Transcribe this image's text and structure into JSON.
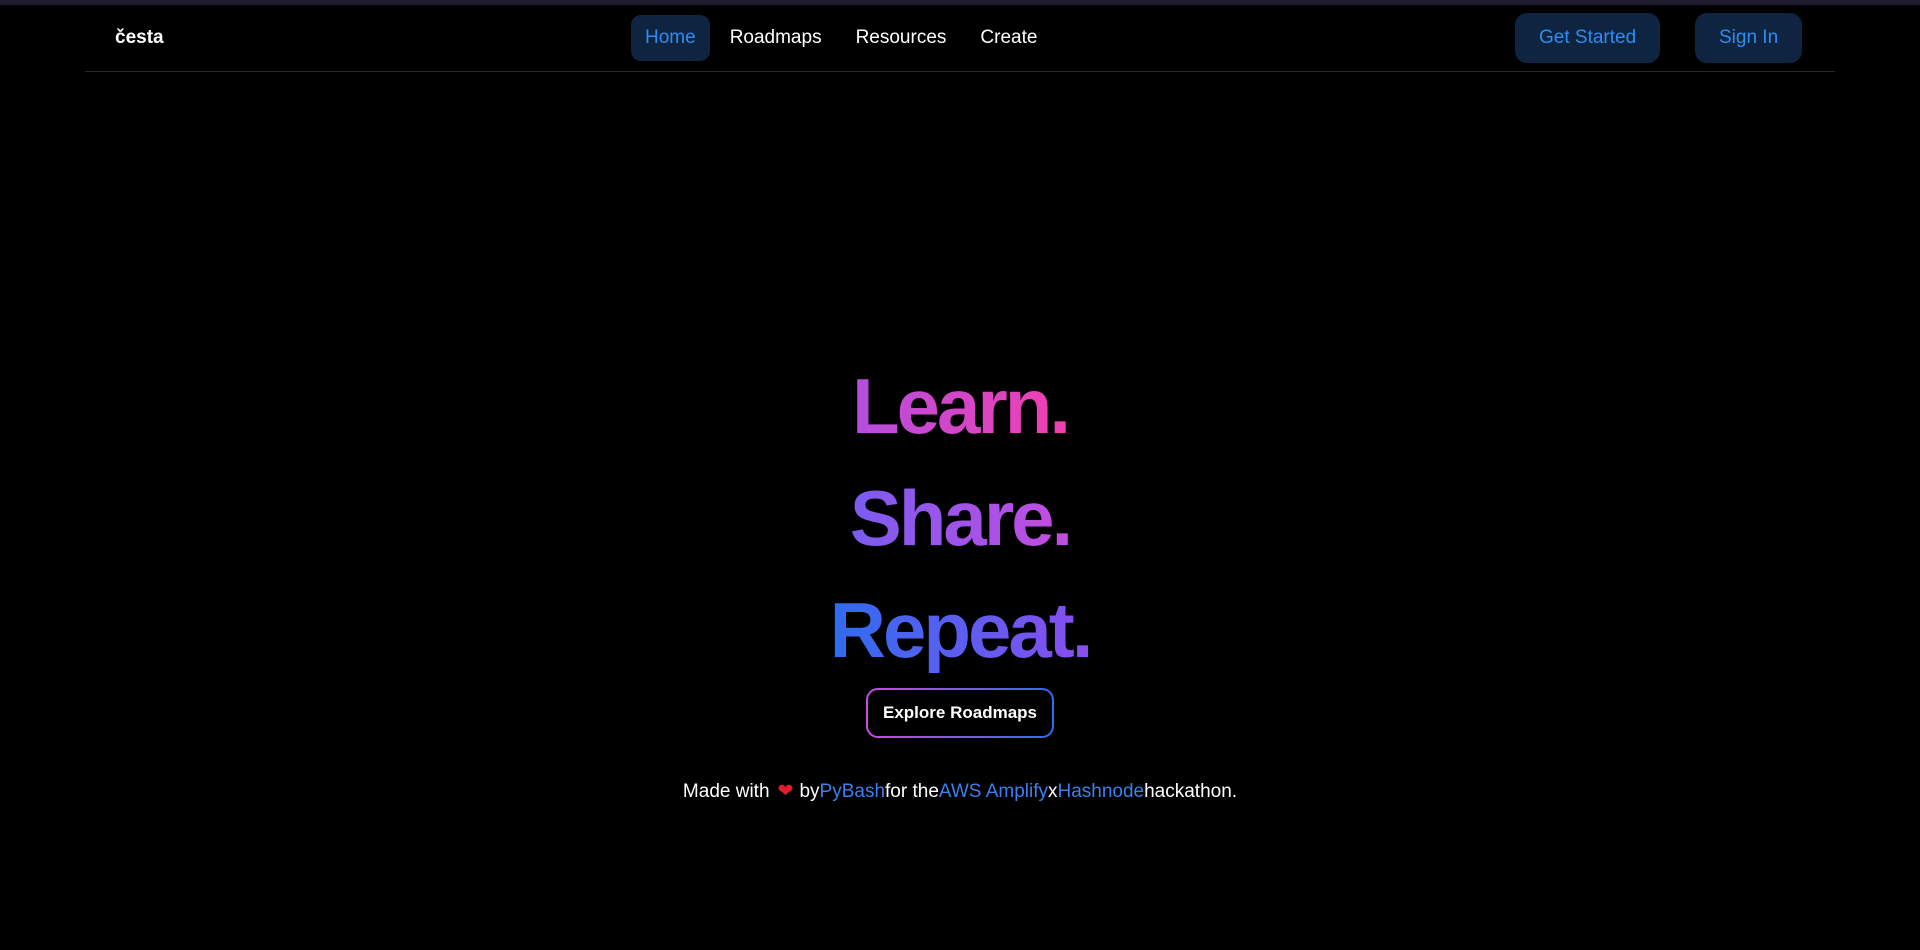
{
  "brand": "česta",
  "nav": {
    "links": [
      "Home",
      "Roadmaps",
      "Resources",
      "Create"
    ],
    "active": "Home",
    "get_started": "Get Started",
    "sign_in": "Sign In"
  },
  "hero": {
    "line1": "Learn.",
    "line2": "Share.",
    "line3": "Repeat.",
    "cta": "Explore Roadmaps"
  },
  "footer": {
    "made_with": "Made with",
    "heart_icon": "heart-icon",
    "by": "by",
    "author": "PyBash",
    "for_the": "for the",
    "partner1": "AWS Amplify",
    "x": "x",
    "partner2": "Hashnode",
    "hackathon": "hackathon."
  },
  "colors": {
    "background": "#000000",
    "accent": "#2f8cf0",
    "button_bg": "#0e2440",
    "gradient_pink": "#f23fb0",
    "gradient_purple": "#8a4ef0",
    "gradient_blue": "#2f6cf0"
  }
}
